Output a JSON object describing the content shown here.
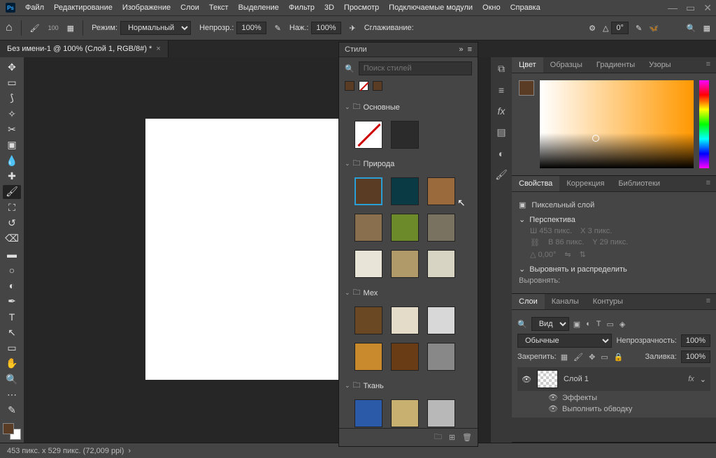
{
  "menubar": {
    "items": [
      "Файл",
      "Редактирование",
      "Изображение",
      "Слои",
      "Текст",
      "Выделение",
      "Фильтр",
      "3D",
      "Просмотр",
      "Подключаемые модули",
      "Окно",
      "Справка"
    ]
  },
  "optbar": {
    "brush_size": "100",
    "mode_label": "Режим:",
    "mode_value": "Нормальный",
    "opacity_label": "Непрозр.:",
    "opacity_value": "100%",
    "press_label": "Наж.:",
    "press_value": "100%",
    "smoothing_label": "Сглаживание:",
    "angle_label": "△",
    "angle_value": "0°"
  },
  "doc_tab": {
    "title": "Без имени-1 @ 100% (Слой 1, RGB/8#) *"
  },
  "styles": {
    "title": "Стили",
    "search_placeholder": "Поиск стилей",
    "groups": [
      {
        "name": "Основные",
        "count": 2
      },
      {
        "name": "Природа",
        "count": 9,
        "selected": 0
      },
      {
        "name": "Мех",
        "count": 6
      },
      {
        "name": "Ткань",
        "count": 3
      }
    ]
  },
  "color_panel": {
    "tabs": [
      "Цвет",
      "Образцы",
      "Градиенты",
      "Узоры"
    ],
    "active": 0
  },
  "props_panel": {
    "tabs": [
      "Свойства",
      "Коррекция",
      "Библиотеки"
    ],
    "active": 0,
    "type_label": "Пиксельный слой",
    "section_transform": "Перспектива",
    "w_label": "Ш",
    "w_value": "453 пикс.",
    "x_label": "X",
    "x_value": "3 пикс.",
    "h_label": "В",
    "h_value": "86 пикс.",
    "y_label": "Y",
    "y_value": "29 пикс.",
    "angle_label": "△",
    "angle_value": "0,00°",
    "section_align": "Выровнять и распределить",
    "align_label": "Выровнять:"
  },
  "layers_panel": {
    "tabs": [
      "Слои",
      "Каналы",
      "Контуры"
    ],
    "active": 0,
    "filter_label": "Вид",
    "blend_value": "Обычные",
    "opacity_label": "Непрозрачность:",
    "opacity_value": "100%",
    "lock_label": "Закрепить:",
    "fill_label": "Заливка:",
    "fill_value": "100%",
    "layer_name": "Слой 1",
    "fx_label": "fx",
    "effects_label": "Эффекты",
    "stroke_label": "Выполнить обводку"
  },
  "status": {
    "text": "453 пикс. x 529 пикс. (72,009 ppi)"
  },
  "style_colors": {
    "osnovnye": [
      "none",
      "#2b2b2b"
    ],
    "priroda": [
      "#5a3c24",
      "#0a3b44",
      "#9a6a3c",
      "#8a6f4e",
      "#6c8a2a",
      "#7a7260",
      "#e8e4d8",
      "#b09a6a",
      "#d8d4c4"
    ],
    "meh": [
      "#6a4824",
      "#e4dcc8",
      "#d8d8d8",
      "#c88a2c",
      "#6a3c16",
      "#888"
    ],
    "tkan": [
      "#2a5aa8",
      "#c8b070",
      "#b8b8b8"
    ]
  }
}
